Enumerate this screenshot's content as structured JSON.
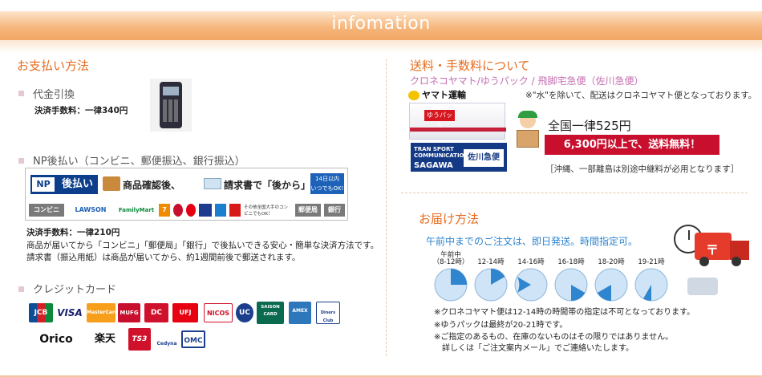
{
  "header": {
    "title": "infomation"
  },
  "payment": {
    "title": "お支払い方法",
    "cod": {
      "title": "代金引換",
      "fee": "決済手数料：一律340円"
    },
    "np": {
      "title": "NP後払い（コンビニ、郵便振込、銀行振込）",
      "banner": {
        "logo": "後払い",
        "logo_np": "NP",
        "text1": "商品確認後、",
        "text2": "請求書で「後から」払える！",
        "badge_line1": "14日以内",
        "badge_line2": "いつでもOK!",
        "stores": [
          "コンビニ",
          "LAWSON",
          "FamilyMart",
          "7",
          "その他全国大手のコンビニでもOK！",
          "郵便局",
          "銀行"
        ]
      },
      "fee": "決済手数料：一律210円",
      "desc1": "商品が届いてから「コンビニ」「郵便局」「銀行」で後払いできる安心・簡単な決済方法です。",
      "desc2": "請求書（振込用紙）は商品が届いてから、約1週間前後で郵送されます。"
    },
    "credit": {
      "title": "クレジットカード",
      "cards_row1": [
        "JCB",
        "VISA",
        "MasterCard",
        "MUFG",
        "DC",
        "UFJ",
        "NICOS",
        "UC",
        "SAISON CARD",
        "AMEX",
        "Diners Club"
      ],
      "cards_row2": [
        "Orico",
        "楽天",
        "TS3",
        "Cedyna",
        "OMC"
      ]
    }
  },
  "shipping": {
    "title": "送料・手数料について",
    "carriers": "クロネコヤマト/ゆうパック / 飛脚宅急便（佐川急便）",
    "yamato_logo": "ヤマト運輸",
    "yupack_label": "ゆうパック",
    "sagawa_top": "TRAN SPORT COMMUNICATION",
    "sagawa_name": "SAGAWA",
    "sagawa_kanji": "佐川急便",
    "note": "※\"水\"を除いて、配送はクロネコヤマト便となっております。",
    "flat": "全国一律525円",
    "free": "6,300円以上で、送料無料！",
    "remote_note": "［沖縄、一部離島は別途中継料が必用となります］"
  },
  "delivery": {
    "title": "お届け方法",
    "same_day": "午前中までのご注文は、即日発送。時間指定可。",
    "truck_logo": "〒",
    "slots": [
      {
        "line1": "午前中",
        "line2": "（8-12時）"
      },
      {
        "line1": "12-14時",
        "line2": ""
      },
      {
        "line1": "14-16時",
        "line2": ""
      },
      {
        "line1": "16-18時",
        "line2": ""
      },
      {
        "line1": "18-20時",
        "line2": ""
      },
      {
        "line1": "19-21時",
        "line2": ""
      }
    ],
    "notes": [
      "※クロネコヤマト便は12-14時の時間帯の指定は不可となっております。",
      "※ゆうパックは最終が20-21時です。",
      "※ご指定のあるもの、在庫のないものはその限りではありません。",
      "　詳しくは「ご注文案内メール」でご連絡いたします。"
    ]
  },
  "colors": {
    "accent": "#e76b1c",
    "subtitle": "#c46fb1",
    "delivery_blue": "#2c84d0",
    "free_banner": "#c8102e"
  }
}
